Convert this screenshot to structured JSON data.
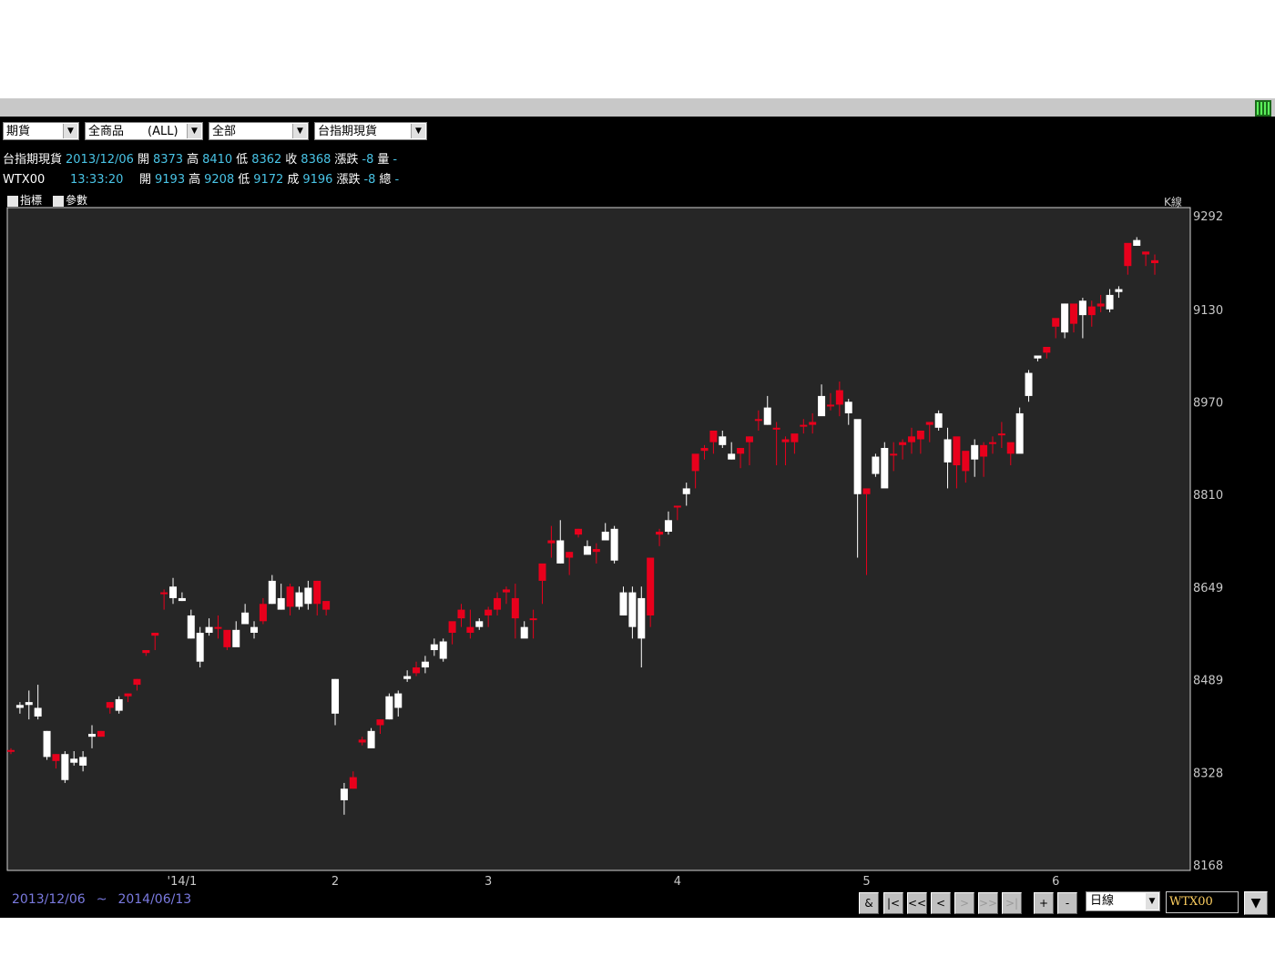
{
  "toolbar": {
    "market": "期貨",
    "category": "全商品　　(ALL)",
    "scope": "全部",
    "product": "台指期現貨"
  },
  "quote_spot": {
    "name": "台指期現貨",
    "date": "2013/12/06",
    "open_label": "開",
    "open": "8373",
    "high_label": "高",
    "high": "8410",
    "low_label": "低",
    "low": "8362",
    "close_label": "收",
    "close": "8368",
    "change_label": "漲跌",
    "change": "-8",
    "volume_label": "量",
    "volume": "-"
  },
  "quote_futures": {
    "name": "WTX00",
    "time": "13:33:20",
    "open_label": "開",
    "open": "9193",
    "high_label": "高",
    "high": "9208",
    "low_label": "低",
    "low": "9172",
    "trade_label": "成",
    "trade": "9196",
    "change_label": "漲跌",
    "change": "-8",
    "total_label": "總",
    "total": "-"
  },
  "chart_controls": {
    "indicator": "指標",
    "params": "參數",
    "kline": "K線"
  },
  "range": {
    "start": "2013/12/06",
    "sep": "~",
    "end": "2014/06/13"
  },
  "nav": {
    "amp": "&",
    "first": "|<",
    "prev_page": "<<",
    "prev": "<",
    "next": ">",
    "next_page": ">>",
    "last": ">|",
    "zoom_in": "+",
    "zoom_out": "-"
  },
  "period_select": "日線",
  "symbol_input": "WTX00",
  "colors": {
    "up": "#e8001c",
    "down": "#ffffff",
    "plot_bg": "#262626",
    "axis_text": "#c8c8c8",
    "quote_value": "#49c4e6"
  },
  "chart_data": {
    "type": "candlestick",
    "y_ticks": [
      9292,
      9130,
      8970,
      8810,
      8649,
      8489,
      8328,
      8168
    ],
    "ylim": [
      8168,
      9292
    ],
    "x_ticks": [
      "'14/1",
      "2",
      "3",
      "4",
      "5",
      "6"
    ],
    "x_tick_index": [
      19,
      36,
      53,
      74,
      95,
      116
    ],
    "candles": [
      [
        8365,
        8370,
        8360,
        8367
      ],
      [
        8445,
        8450,
        8430,
        8440
      ],
      [
        8450,
        8470,
        8420,
        8445
      ],
      [
        8440,
        8480,
        8420,
        8425
      ],
      [
        8400,
        8400,
        8350,
        8355
      ],
      [
        8348,
        8360,
        8335,
        8360
      ],
      [
        8360,
        8365,
        8310,
        8315
      ],
      [
        8352,
        8365,
        8340,
        8345
      ],
      [
        8355,
        8365,
        8330,
        8340
      ],
      [
        8395,
        8410,
        8370,
        8390
      ],
      [
        8390,
        8400,
        8390,
        8400
      ],
      [
        8440,
        8450,
        8430,
        8450
      ],
      [
        8455,
        8460,
        8430,
        8435
      ],
      [
        8460,
        8465,
        8450,
        8465
      ],
      [
        8480,
        8490,
        8470,
        8490
      ],
      [
        8535,
        8540,
        8530,
        8540
      ],
      [
        8565,
        8570,
        8540,
        8570
      ],
      [
        8640,
        8645,
        8610,
        8640
      ],
      [
        8650,
        8665,
        8620,
        8630
      ],
      [
        8630,
        8640,
        8625,
        8625
      ],
      [
        8600,
        8610,
        8560,
        8560
      ],
      [
        8570,
        8580,
        8510,
        8520
      ],
      [
        8580,
        8595,
        8565,
        8570
      ],
      [
        8580,
        8600,
        8560,
        8580
      ],
      [
        8545,
        8560,
        8540,
        8575
      ],
      [
        8575,
        8590,
        8555,
        8545
      ],
      [
        8605,
        8620,
        8590,
        8585
      ],
      [
        8580,
        8590,
        8560,
        8570
      ],
      [
        8590,
        8630,
        8585,
        8620
      ],
      [
        8660,
        8670,
        8620,
        8620
      ],
      [
        8630,
        8655,
        8610,
        8610
      ],
      [
        8615,
        8655,
        8600,
        8650
      ],
      [
        8640,
        8650,
        8610,
        8615
      ],
      [
        8648,
        8660,
        8610,
        8620
      ],
      [
        8620,
        8660,
        8600,
        8660
      ],
      [
        8610,
        8620,
        8600,
        8625
      ],
      [
        8490,
        8490,
        8410,
        8430
      ],
      [
        8300,
        8310,
        8255,
        8280
      ],
      [
        8300,
        8330,
        8300,
        8320
      ],
      [
        8380,
        8390,
        8375,
        8385
      ],
      [
        8400,
        8405,
        8380,
        8370
      ],
      [
        8410,
        8420,
        8395,
        8420
      ],
      [
        8460,
        8465,
        8420,
        8420
      ],
      [
        8465,
        8470,
        8425,
        8440
      ],
      [
        8495,
        8505,
        8485,
        8490
      ],
      [
        8500,
        8520,
        8495,
        8510
      ],
      [
        8520,
        8530,
        8500,
        8510
      ],
      [
        8550,
        8560,
        8530,
        8540
      ],
      [
        8555,
        8560,
        8520,
        8525
      ],
      [
        8570,
        8580,
        8550,
        8590
      ],
      [
        8595,
        8620,
        8580,
        8610
      ],
      [
        8570,
        8610,
        8560,
        8580
      ],
      [
        8590,
        8595,
        8575,
        8580
      ],
      [
        8600,
        8615,
        8580,
        8610
      ],
      [
        8610,
        8640,
        8600,
        8630
      ],
      [
        8640,
        8650,
        8620,
        8645
      ],
      [
        8595,
        8655,
        8560,
        8630
      ],
      [
        8580,
        8590,
        8565,
        8560
      ],
      [
        8595,
        8610,
        8560,
        8595
      ],
      [
        8660,
        8660,
        8620,
        8690
      ],
      [
        8725,
        8755,
        8700,
        8730
      ],
      [
        8730,
        8765,
        8690,
        8690
      ],
      [
        8700,
        8710,
        8670,
        8710
      ],
      [
        8740,
        8750,
        8735,
        8750
      ],
      [
        8720,
        8730,
        8710,
        8705
      ],
      [
        8710,
        8725,
        8690,
        8715
      ],
      [
        8745,
        8760,
        8740,
        8730
      ],
      [
        8750,
        8755,
        8690,
        8695
      ],
      [
        8640,
        8650,
        8600,
        8600
      ],
      [
        8640,
        8650,
        8560,
        8580
      ],
      [
        8630,
        8650,
        8510,
        8560
      ],
      [
        8600,
        8690,
        8580,
        8700
      ],
      [
        8740,
        8750,
        8720,
        8745
      ],
      [
        8765,
        8780,
        8740,
        8745
      ],
      [
        8790,
        8790,
        8765,
        8790
      ],
      [
        8820,
        8830,
        8790,
        8810
      ],
      [
        8850,
        8860,
        8820,
        8880
      ],
      [
        8885,
        8895,
        8870,
        8890
      ],
      [
        8900,
        8900,
        8880,
        8920
      ],
      [
        8910,
        8920,
        8890,
        8895
      ],
      [
        8880,
        8900,
        8870,
        8870
      ],
      [
        8880,
        8890,
        8855,
        8890
      ],
      [
        8900,
        8910,
        8860,
        8910
      ],
      [
        8940,
        8955,
        8920,
        8940
      ],
      [
        8960,
        8980,
        8930,
        8930
      ],
      [
        8925,
        8935,
        8860,
        8925
      ],
      [
        8900,
        8910,
        8860,
        8905
      ],
      [
        8900,
        8910,
        8880,
        8915
      ],
      [
        8930,
        8940,
        8915,
        8930
      ],
      [
        8930,
        8950,
        8915,
        8935
      ],
      [
        8980,
        9000,
        8960,
        8945
      ],
      [
        8965,
        8985,
        8955,
        8965
      ],
      [
        8965,
        9005,
        8945,
        8990
      ],
      [
        8970,
        8975,
        8930,
        8950
      ],
      [
        8940,
        8930,
        8700,
        8810
      ],
      [
        8810,
        8810,
        8670,
        8820
      ],
      [
        8875,
        8880,
        8840,
        8845
      ],
      [
        8890,
        8900,
        8870,
        8820
      ],
      [
        8880,
        8900,
        8850,
        8880
      ],
      [
        8895,
        8905,
        8870,
        8900
      ],
      [
        8900,
        8925,
        8880,
        8910
      ],
      [
        8905,
        8910,
        8880,
        8920
      ],
      [
        8930,
        8935,
        8900,
        8935
      ],
      [
        8950,
        8955,
        8920,
        8925
      ],
      [
        8905,
        8925,
        8820,
        8865
      ],
      [
        8860,
        8875,
        8820,
        8910
      ],
      [
        8850,
        8860,
        8830,
        8885
      ],
      [
        8895,
        8905,
        8840,
        8870
      ],
      [
        8875,
        8900,
        8840,
        8895
      ],
      [
        8900,
        8910,
        8880,
        8900
      ],
      [
        8915,
        8935,
        8890,
        8915
      ],
      [
        8880,
        8890,
        8860,
        8900
      ],
      [
        8950,
        8960,
        8950,
        8880
      ],
      [
        9020,
        9025,
        8970,
        8980
      ],
      [
        9050,
        9050,
        9040,
        9045
      ],
      [
        9055,
        9060,
        9045,
        9065
      ],
      [
        9100,
        9100,
        9080,
        9115
      ],
      [
        9140,
        9140,
        9080,
        9090
      ],
      [
        9105,
        9115,
        9090,
        9140
      ],
      [
        9145,
        9150,
        9080,
        9120
      ],
      [
        9120,
        9145,
        9100,
        9135
      ],
      [
        9135,
        9155,
        9125,
        9140
      ],
      [
        9155,
        9165,
        9125,
        9130
      ],
      [
        9165,
        9170,
        9150,
        9160
      ],
      [
        9205,
        9210,
        9190,
        9245
      ],
      [
        9250,
        9255,
        9240,
        9240
      ],
      [
        9225,
        9230,
        9205,
        9230
      ],
      [
        9210,
        9225,
        9190,
        9215
      ]
    ]
  }
}
